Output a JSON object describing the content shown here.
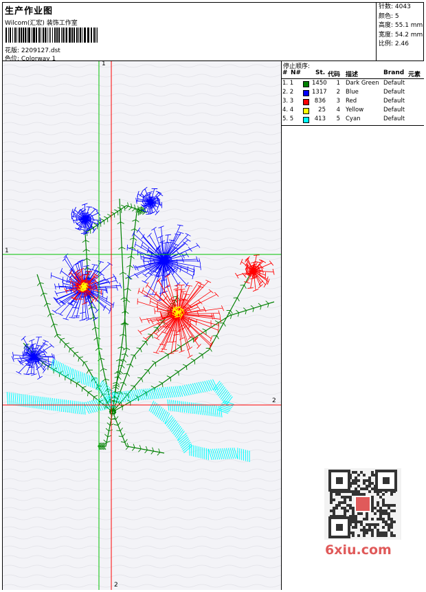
{
  "header": {
    "title": "生产作业图",
    "company": "Wilcom(汇宏) 装饰工作室",
    "design_label": "花版:",
    "design_value": "2209127.dst",
    "colorway_label": "色位:",
    "colorway_value": "Colorway 1"
  },
  "stats": {
    "stitches": "针数: 4043",
    "colors": "颜色: 5",
    "height": "高度: 55.1 mm",
    "width": "宽度: 54.2 mm",
    "scale": "比例: 2.46"
  },
  "stop_sequence": {
    "title": "停止顺序:",
    "columns": [
      "#",
      "N#",
      "St.",
      "代码",
      "描述",
      "Brand",
      "元素"
    ],
    "rows": [
      {
        "index": "1. 1",
        "stitches": "1450",
        "code": "1",
        "desc": "Dark Green",
        "brand": "Default",
        "color": "#008000"
      },
      {
        "index": "2. 2",
        "stitches": "1317",
        "code": "2",
        "desc": "Blue",
        "brand": "Default",
        "color": "#0000ff"
      },
      {
        "index": "3. 3",
        "stitches": "836",
        "code": "3",
        "desc": "Red",
        "brand": "Default",
        "color": "#ff0000"
      },
      {
        "index": "4. 4",
        "stitches": "25",
        "code": "4",
        "desc": "Yellow",
        "brand": "Default",
        "color": "#ffff00"
      },
      {
        "index": "5. 5",
        "stitches": "413",
        "code": "5",
        "desc": "Cyan",
        "brand": "Default",
        "color": "#00ffff"
      }
    ]
  },
  "axes": {
    "v1_label": "1",
    "h1_label": "1",
    "h2_label": "2",
    "v2_label": "2",
    "green_color": "#00c000",
    "red_color": "#ff0000"
  },
  "watermark": {
    "text": "6xiu.com"
  }
}
